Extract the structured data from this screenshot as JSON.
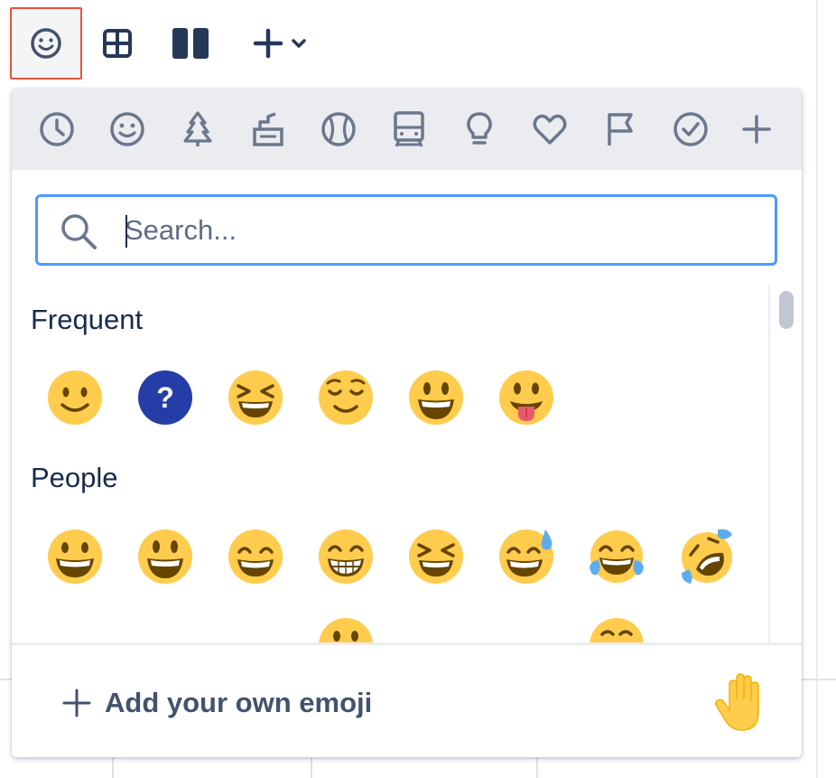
{
  "toolbar": {
    "buttons": [
      {
        "name": "emoji",
        "icon": "smiley-icon",
        "active": true
      },
      {
        "name": "table",
        "icon": "table-icon"
      },
      {
        "name": "layouts",
        "icon": "columns-icon"
      },
      {
        "name": "insert",
        "icon": "plus-icon"
      }
    ]
  },
  "picker": {
    "categories": [
      {
        "id": "frequent",
        "icon": "clock-icon"
      },
      {
        "id": "people",
        "icon": "smiley-icon"
      },
      {
        "id": "nature",
        "icon": "tree-icon"
      },
      {
        "id": "food",
        "icon": "food-icon"
      },
      {
        "id": "activity",
        "icon": "ball-icon"
      },
      {
        "id": "travel",
        "icon": "train-icon"
      },
      {
        "id": "objects",
        "icon": "lightbulb-icon"
      },
      {
        "id": "symbols",
        "icon": "heart-icon"
      },
      {
        "id": "flags",
        "icon": "flag-icon"
      },
      {
        "id": "productivity",
        "icon": "check-circle-icon"
      },
      {
        "id": "custom",
        "icon": "plus-icon"
      }
    ],
    "search": {
      "placeholder": "Search...",
      "value": ""
    },
    "sections": {
      "frequent": {
        "title": "Frequent",
        "emojis": [
          "slightly-smiling-face",
          "question-mark-emoji",
          "laughing-face",
          "relieved-face",
          "smiley-face",
          "tongue-face"
        ]
      },
      "people": {
        "title": "People",
        "emojis": [
          "grinning-face",
          "smiley-face",
          "smile-face",
          "grin-face",
          "laughing-face",
          "sweat-smile-face",
          "joy-face",
          "rolling-laughing-face"
        ]
      }
    },
    "footer": {
      "add_label": "Add your own emoji",
      "tone_icon": "raised-hand-icon"
    }
  },
  "colors": {
    "accent": "#4c9aff",
    "active_border": "#e2553d",
    "text": "#172b4d",
    "icon": "#42526e",
    "emoji_yellow": "#ffcc4d",
    "emoji_dark": "#664500",
    "question_blue": "#253ea7"
  }
}
